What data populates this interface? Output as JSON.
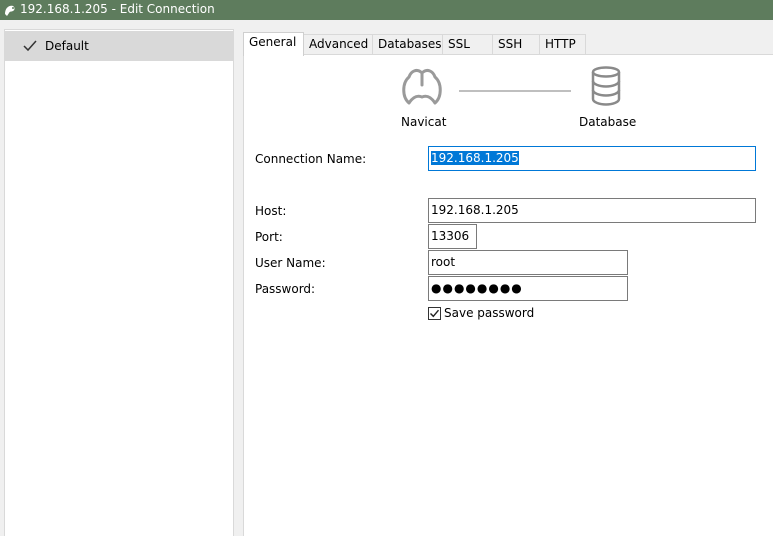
{
  "window": {
    "title": "192.168.1.205 - Edit Connection"
  },
  "sidebar": {
    "items": [
      {
        "label": "Default",
        "selected": true
      }
    ]
  },
  "tabs": [
    {
      "label": "General",
      "active": true
    },
    {
      "label": "Advanced",
      "active": false
    },
    {
      "label": "Databases",
      "active": false
    },
    {
      "label": "SSL",
      "active": false
    },
    {
      "label": "SSH",
      "active": false
    },
    {
      "label": "HTTP",
      "active": false
    }
  ],
  "diagram": {
    "left_label": "Navicat",
    "right_label": "Database"
  },
  "form": {
    "connection_name_label": "Connection Name:",
    "connection_name_value": "192.168.1.205",
    "host_label": "Host:",
    "host_value": "192.168.1.205",
    "port_label": "Port:",
    "port_value": "13306",
    "username_label": "User Name:",
    "username_value": "root",
    "password_label": "Password:",
    "password_value": "●●●●●●●●",
    "save_password_label": "Save password",
    "save_password_checked": true
  },
  "colors": {
    "titlebar": "#5e7c5d",
    "selection": "#0078d7",
    "sidebar_selected": "#d9d9d9"
  }
}
